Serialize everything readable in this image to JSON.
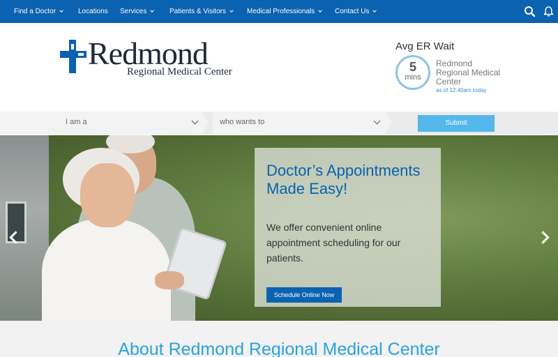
{
  "nav": {
    "items": [
      {
        "label": "Find a Doctor",
        "has_dropdown": true
      },
      {
        "label": "Locations",
        "has_dropdown": false
      },
      {
        "label": "Services",
        "has_dropdown": true
      },
      {
        "label": "Patients & Visitors",
        "has_dropdown": true
      },
      {
        "label": "Medical Professionals",
        "has_dropdown": true
      },
      {
        "label": "Contact Us",
        "has_dropdown": true
      }
    ],
    "icons": [
      "search-icon",
      "bell-icon"
    ],
    "bg_color": "#0a62b0"
  },
  "logo": {
    "name": "Redmond",
    "subtitle": "Regional Medical Center",
    "icon": "medical-cross-icon"
  },
  "er_wait": {
    "title": "Avg ER Wait",
    "value": "5",
    "unit": "mins",
    "location": "Redmond Regional Medical Center",
    "as_of": "as of 12:40am today"
  },
  "selector": {
    "i_am": "I am a",
    "wants_to": "who wants to",
    "submit_label": "Submit"
  },
  "hero": {
    "title": "Doctor’s Appointments Made Easy!",
    "text": "We offer convenient online appointment scheduling for our patients.",
    "button_label": "Schedule Online Now"
  },
  "about": {
    "title": "About Redmond Regional Medical Center"
  },
  "colors": {
    "brand_blue": "#0a62b0",
    "accent_light_blue": "#54b8ec",
    "about_title": "#2aa2de"
  }
}
